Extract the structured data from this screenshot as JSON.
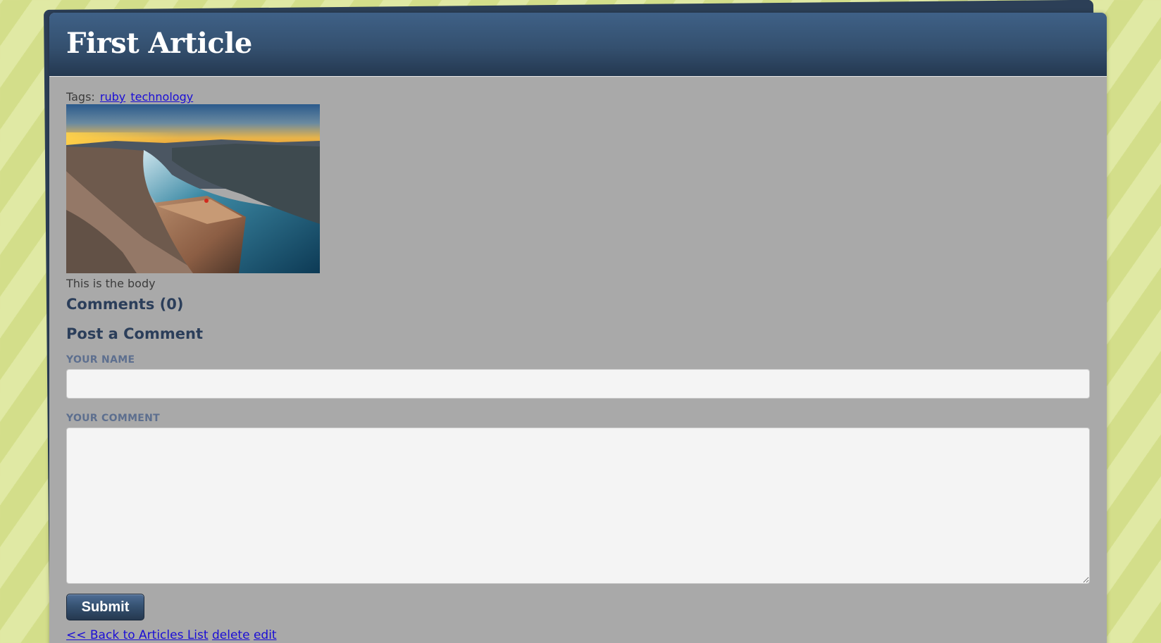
{
  "article": {
    "title": "First Article",
    "tags_label": "Tags:",
    "tags": [
      "ruby",
      "technology"
    ],
    "image_alt": "fjord cliff landscape photo",
    "body": "This is the body"
  },
  "comments": {
    "heading": "Comments (0)"
  },
  "comment_form": {
    "heading": "Post a Comment",
    "name_label": "YOUR NAME",
    "name_value": "",
    "comment_label": "YOUR COMMENT",
    "comment_value": "",
    "submit_label": "Submit"
  },
  "links": {
    "back": "<< Back to Articles List",
    "delete": "delete",
    "edit": "edit"
  },
  "colors": {
    "header": "#34506f",
    "panel": "#a9a9a9",
    "background": "#d6e08f",
    "link": "#1a0dd6"
  }
}
